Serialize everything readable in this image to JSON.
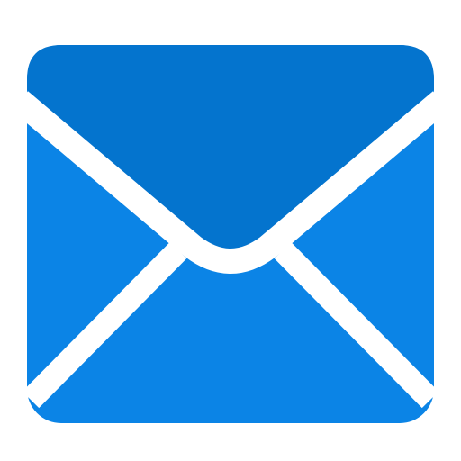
{
  "icon": {
    "name": "mail-icon",
    "colors": {
      "background": "#ffffff",
      "envelope_body": "#0b84e6",
      "envelope_flap": "#0474ce",
      "separator": "#ffffff"
    }
  }
}
